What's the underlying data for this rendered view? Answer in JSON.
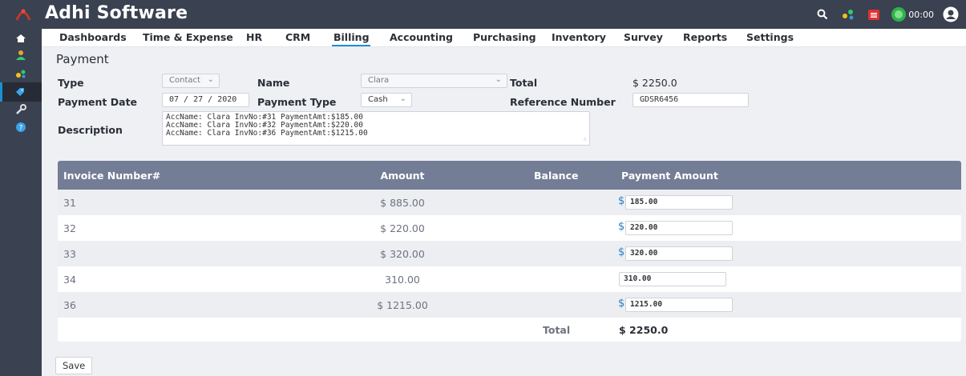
{
  "app": {
    "title": "Adhi Software",
    "timer": "00:00"
  },
  "colors": {
    "topbar": "#3a4150",
    "accent": "#1d8fd6",
    "table_header": "#737d96"
  },
  "top_icons": [
    "search-icon",
    "share-icon",
    "calendar-icon",
    "timer-icon",
    "user-icon"
  ],
  "sidebar": {
    "items": [
      {
        "icon": "home-icon"
      },
      {
        "icon": "user-icon"
      },
      {
        "icon": "share-icon"
      },
      {
        "icon": "tag-icon",
        "active": true
      },
      {
        "icon": "wrench-icon"
      },
      {
        "icon": "help-icon"
      }
    ]
  },
  "nav": {
    "items": [
      "Dashboards",
      "Time & Expense",
      "HR",
      "CRM",
      "Billing",
      "Accounting",
      "Purchasing",
      "Inventory",
      "Survey",
      "Reports",
      "Settings"
    ],
    "active": "Billing"
  },
  "page": {
    "heading": "Payment"
  },
  "form": {
    "type_label": "Type",
    "type_value": "Contact",
    "name_label": "Name",
    "name_value": "Clara",
    "total_label": "Total",
    "total_value": "$ 2250.0",
    "date_label": "Payment Date",
    "date_value": "07 / 27 / 2020",
    "ptype_label": "Payment Type",
    "ptype_value": "Cash",
    "ref_label": "Reference Number",
    "ref_value": "GDSR6456",
    "desc_label": "Description",
    "desc_lines": [
      "AccName: Clara InvNo:#31 PaymentAmt:$185.00",
      "AccName: Clara InvNo:#32 PaymentAmt:$220.00",
      "AccName: Clara InvNo:#36 PaymentAmt:$1215.00"
    ]
  },
  "table": {
    "headers": {
      "invoice": "Invoice Number#",
      "amount": "Amount",
      "balance": "Balance",
      "payment": "Payment Amount"
    },
    "rows": [
      {
        "invoice": "31",
        "amount": "$ 885.00",
        "currency": "$",
        "payment": "185.00"
      },
      {
        "invoice": "32",
        "amount": "$ 220.00",
        "currency": "$",
        "payment": "220.00"
      },
      {
        "invoice": "33",
        "amount": "$ 320.00",
        "currency": "$",
        "payment": "320.00"
      },
      {
        "invoice": "34",
        "amount": "310.00",
        "currency": "",
        "payment": "310.00"
      },
      {
        "invoice": "36",
        "amount": "$ 1215.00",
        "currency": "$",
        "payment": "1215.00"
      }
    ],
    "total_label": "Total",
    "total_value": "$ 2250.0"
  },
  "actions": {
    "save_label": "Save"
  }
}
